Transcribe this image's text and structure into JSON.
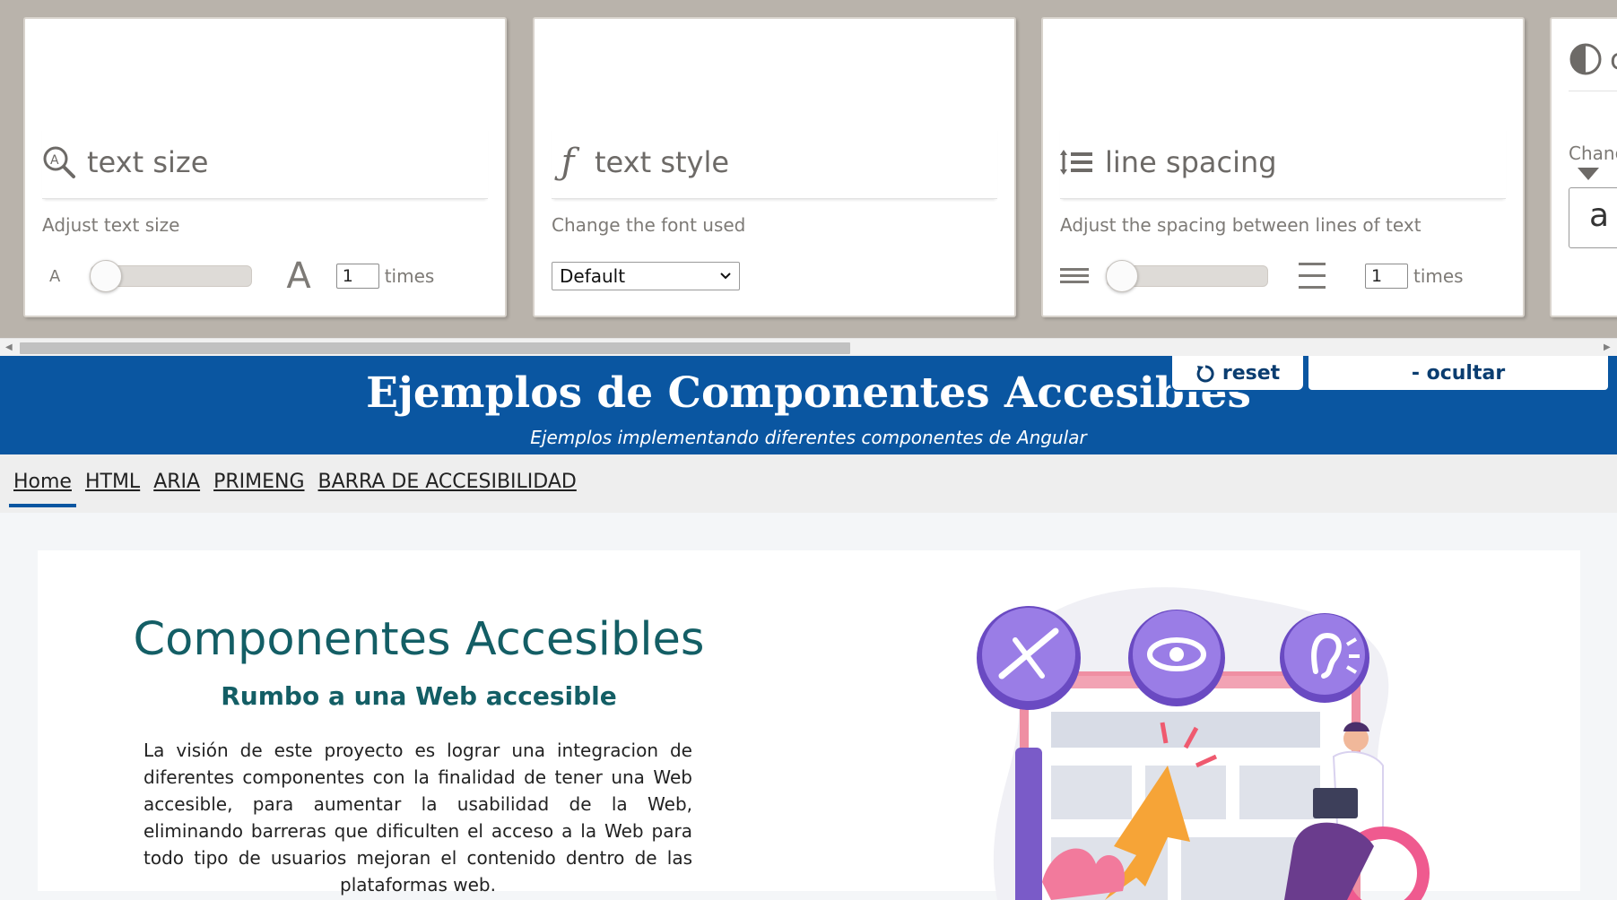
{
  "toolbar": {
    "cards": [
      {
        "title": "text size",
        "icon": "magnifier-icon",
        "description": "Adjust text size",
        "value": "1",
        "unit": "times",
        "small_glyph": "A",
        "large_glyph": "A"
      },
      {
        "title": "text style",
        "icon": "function-f-icon",
        "description": "Change the font used",
        "selected_font": "Default"
      },
      {
        "title": "line spacing",
        "icon": "line-spacing-icon",
        "description": "Adjust the spacing between lines of text",
        "value": "1",
        "unit": "times"
      },
      {
        "title": "c",
        "icon": "contrast-icon",
        "description": "Chang",
        "preview": "a"
      }
    ]
  },
  "header": {
    "title": "Ejemplos de Componentes Accesibles",
    "subtitle": "Ejemplos implementando diferentes componentes de Angular",
    "reset_label": "reset",
    "hide_label": "- ocultar"
  },
  "nav": {
    "items": [
      "Home",
      "HTML",
      "ARIA",
      "PRIMENG",
      "BARRA DE ACCESIBILIDAD"
    ]
  },
  "hero": {
    "title": "Componentes Accesibles",
    "subtitle": "Rumbo a una Web accesible",
    "body": "La visión de este proyecto es lograr una integracion de diferentes componentes con la finalidad de tener una Web accesible, para aumentar la usabilidad de la Web, eliminando barreras que dificulten el acceso a la Web para todo tipo de usuarios mejoran el contenido dentro de las plataformas web."
  },
  "colors": {
    "header_bg": "#0a56a1",
    "hero_title": "#135e65",
    "toolbar_bg": "#b9b3ab",
    "illustration_purple": "#8b68e0"
  }
}
